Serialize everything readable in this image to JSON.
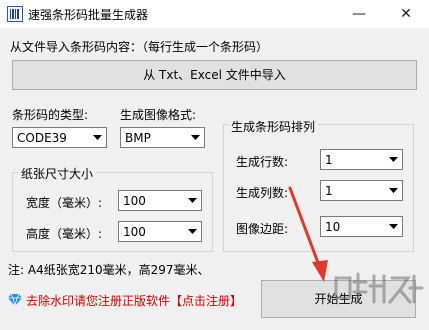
{
  "window": {
    "title": "速强条形码批量生成器",
    "minimize_glyph": "—",
    "close_glyph": "✕"
  },
  "import": {
    "label": "从文件导入条形码内容：（每行生成一个条形码）",
    "button": "从 Txt、Excel 文件中导入"
  },
  "barcode": {
    "type_label": "条形码的类型:",
    "type_value": "CODE39",
    "format_label": "生成图像格式:",
    "format_value": "BMP"
  },
  "paper": {
    "legend": "纸张尺寸大小",
    "width_label": "宽度（毫米）:",
    "width_value": "100",
    "height_label": "高度（毫米）:",
    "height_value": "100"
  },
  "layout": {
    "legend": "生成条形码排列",
    "rows_label": "生成行数:",
    "rows_value": "1",
    "cols_label": "生成列数:",
    "cols_value": "1",
    "margin_label": "图像边距:",
    "margin_value": "10"
  },
  "note": "注: A4纸张宽210毫米，高297毫米、",
  "promo": {
    "text": "去除水印请您注册正版软件",
    "link": "【点击注册】",
    "accent": "#d40000"
  },
  "generate_button": "开始生成",
  "icons": {
    "app": "barcode-icon",
    "promo": "diamond-icon"
  }
}
